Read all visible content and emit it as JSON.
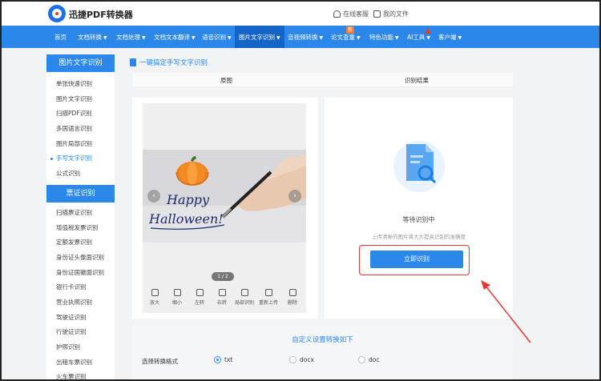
{
  "header": {
    "logo_text": "迅捷PDF转换器",
    "service_label": "在线客服",
    "files_label": "我的文件"
  },
  "nav": {
    "items": [
      {
        "label": "首页",
        "has_caret": false
      },
      {
        "label": "文档转换",
        "has_caret": true
      },
      {
        "label": "文档处理",
        "has_caret": true
      },
      {
        "label": "文档文本翻译",
        "has_caret": true
      },
      {
        "label": "语音识别",
        "has_caret": true
      },
      {
        "label": "图片文字识别",
        "has_caret": true
      },
      {
        "label": "音视频转换",
        "has_caret": true
      },
      {
        "label": "论文查重",
        "has_caret": true
      },
      {
        "label": "特色功能",
        "has_caret": true
      },
      {
        "label": "AI工具",
        "has_caret": true
      },
      {
        "label": "客户端",
        "has_caret": true
      }
    ],
    "badge_new": "新",
    "active_color": "#1565c8",
    "bar_color": "#2b87ea"
  },
  "sidebar": {
    "section1_title": "图片文字识别",
    "section1_items": [
      "单张快速识别",
      "图片文字识别",
      "扫描PDF识别",
      "多国语言识别",
      "图片局部识别",
      "手写文字识别",
      "公式识别"
    ],
    "section1_active": "手写文字识别",
    "section2_title": "票证识别",
    "section2_items": [
      "扫描票证识别",
      "增值税发票识别",
      "定额发票识别",
      "身份证头像面识别",
      "身份证国徽面识别",
      "银行卡识别",
      "营业执照识别",
      "驾驶证识别",
      "行驶证识别",
      "护照识别",
      "出租车票识别",
      "火车票识别"
    ]
  },
  "main": {
    "page_title": "一键搞定手写文字识别",
    "col_original": "原图",
    "col_result": "识别结果",
    "image_text_line1": "Happy",
    "image_text_line2": "Halloween!",
    "pager": "1 / 2",
    "tools": [
      "放大",
      "缩小",
      "左转",
      "右转",
      "局部识别",
      "重新上传",
      "删除"
    ],
    "wait_text": "等待识别中",
    "hint_text": "上传清晰的图片将大大提高识别的准确度",
    "start_button": "立即识别",
    "settings_title": "自定义设置转换如下",
    "format_label": "选择转换格式",
    "formats": [
      "txt",
      "docx",
      "doc"
    ],
    "selected_format": "txt"
  },
  "colors": {
    "accent": "#2b87ea",
    "annotation_red": "#e53935"
  }
}
